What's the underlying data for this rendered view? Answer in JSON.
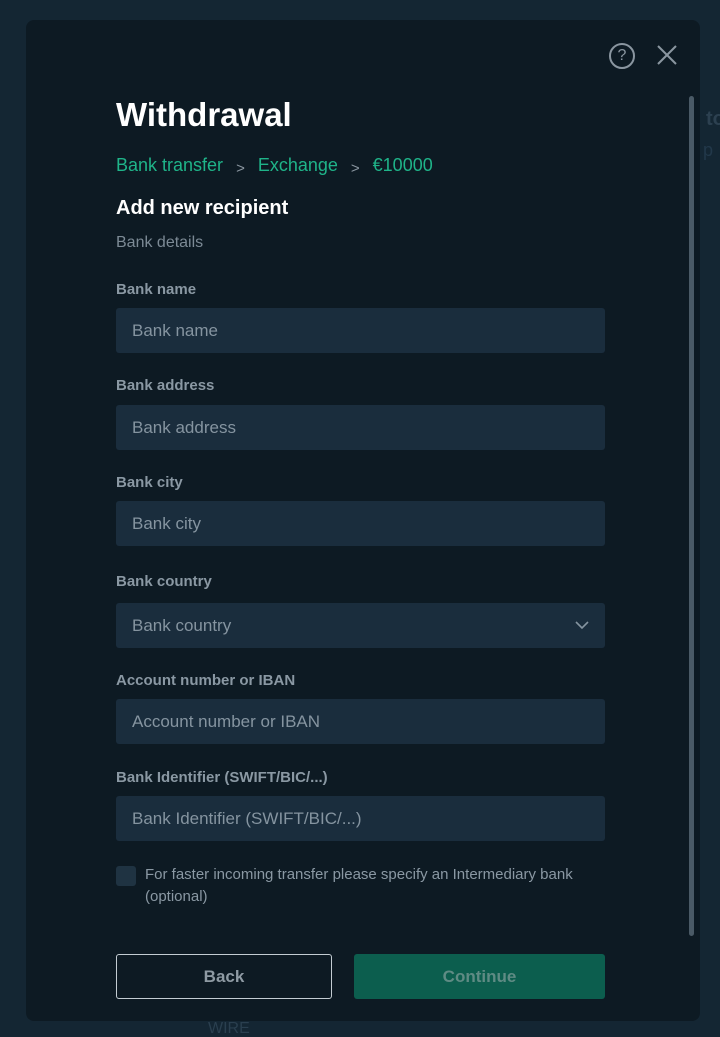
{
  "backdrop": {
    "fragment_1": "to",
    "fragment_2": "p",
    "fragment_3": "WIRE"
  },
  "modal": {
    "title": "Withdrawal",
    "help_glyph": "?",
    "breadcrumb": [
      "Bank transfer",
      "Exchange",
      "€10000"
    ],
    "breadcrumb_separator": ">",
    "section_title": "Add new recipient",
    "section_subtitle": "Bank details",
    "fields": [
      {
        "label": "Bank name",
        "placeholder": "Bank name",
        "type": "text"
      },
      {
        "label": "Bank address",
        "placeholder": "Bank address",
        "type": "text"
      },
      {
        "label": "Bank city",
        "placeholder": "Bank city",
        "type": "text"
      },
      {
        "label": "Bank country",
        "placeholder": "Bank country",
        "type": "select"
      },
      {
        "label": "Account number or IBAN",
        "placeholder": "Account number or IBAN",
        "type": "text"
      },
      {
        "label": "Bank Identifier (SWIFT/BIC/...)",
        "placeholder": "Bank Identifier (SWIFT/BIC/...)",
        "type": "text"
      }
    ],
    "intermediary_checkbox": {
      "label": "For faster incoming transfer please specify an Intermediary bank (optional)",
      "checked": false
    },
    "buttons": {
      "back": "Back",
      "continue": "Continue"
    }
  },
  "colors": {
    "accent": "#1fb489",
    "modal_bg": "#0d1a23",
    "field_bg": "#1a2d3d",
    "continue_bg": "#0c5e4e"
  },
  "icons": {
    "help": "question-circle-icon",
    "close": "close-icon",
    "dropdown": "chevron-down-icon"
  }
}
